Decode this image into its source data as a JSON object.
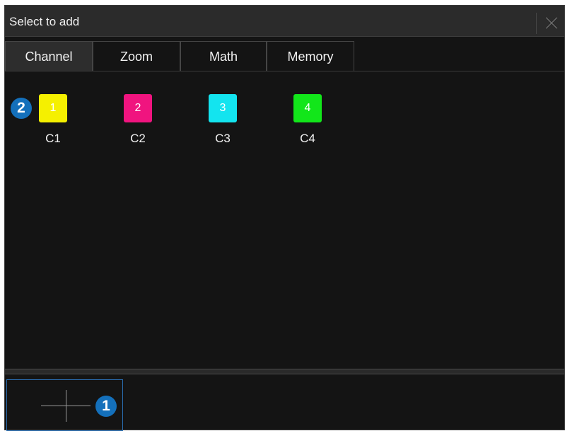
{
  "dialog": {
    "title": "Select to add"
  },
  "tabs": [
    {
      "label": "Channel",
      "active": true
    },
    {
      "label": "Zoom",
      "active": false
    },
    {
      "label": "Math",
      "active": false
    },
    {
      "label": "Memory",
      "active": false
    }
  ],
  "channels": [
    {
      "number": "1",
      "label": "C1",
      "color": "#f5f000"
    },
    {
      "number": "2",
      "label": "C2",
      "color": "#f0147f"
    },
    {
      "number": "3",
      "label": "C3",
      "color": "#13e4ef"
    },
    {
      "number": "4",
      "label": "C4",
      "color": "#12e61a"
    }
  ],
  "callouts": {
    "add_slot_badge": "1",
    "channel_badge": "2",
    "color": "#1470bb"
  },
  "icons": {
    "close": "close-icon",
    "add": "plus-icon"
  }
}
